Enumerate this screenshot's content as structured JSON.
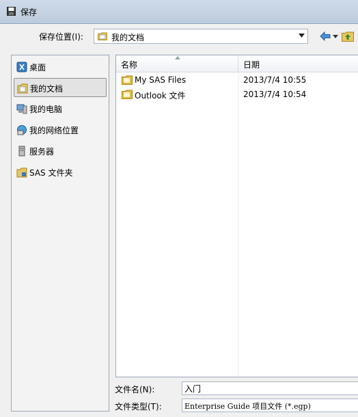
{
  "window": {
    "title": "保存"
  },
  "location": {
    "label": "保存位置(I):",
    "value": "我的文档"
  },
  "places": [
    {
      "label": "桌面",
      "icon": "desktop-icon"
    },
    {
      "label": "我的文档",
      "icon": "documents-icon"
    },
    {
      "label": "我的电脑",
      "icon": "computer-icon"
    },
    {
      "label": "我的网络位置",
      "icon": "network-icon"
    },
    {
      "label": "服务器",
      "icon": "server-icon"
    },
    {
      "label": "SAS 文件夹",
      "icon": "sas-folder-icon"
    }
  ],
  "filelist": {
    "headers": {
      "name": "名称",
      "date": "日期"
    },
    "rows": [
      {
        "name": "My SAS Files",
        "date": "2013/7/4 10:55"
      },
      {
        "name": "Outlook 文件",
        "date": "2013/7/4 10:54"
      }
    ]
  },
  "filename": {
    "label": "文件名(N):",
    "value": "入门"
  },
  "filetype": {
    "label": "文件类型(T):",
    "value": "Enterprise Guide 项目文件 (*.egp)"
  },
  "colors": {
    "titlebar": "#c4d3e6",
    "selection": "#e3e3e3",
    "folder": "#e8b83a"
  }
}
